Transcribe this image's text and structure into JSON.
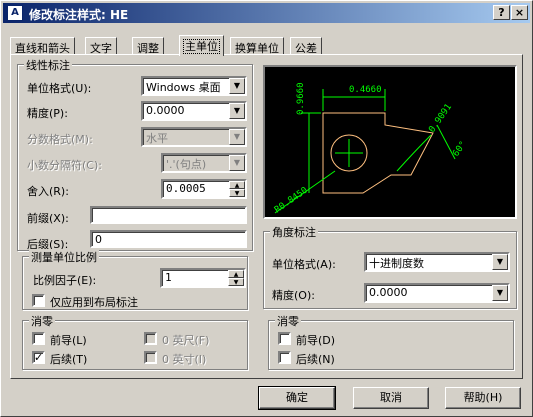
{
  "window": {
    "title": "修改标注样式: HE",
    "help_glyph": "?",
    "close_glyph": "×"
  },
  "tabs": [
    "直线和箭头",
    "文字",
    "调整",
    "主单位",
    "换算单位",
    "公差"
  ],
  "linear": {
    "group_title": "线性标注",
    "unit_format_label": "单位格式(U):",
    "unit_format_value": "Windows 桌面",
    "precision_label": "精度(P):",
    "precision_value": "0.0000",
    "fraction_label": "分数格式(M):",
    "fraction_value": "水平",
    "decimal_sep_label": "小数分隔符(C):",
    "decimal_sep_value": "'.'(句点)",
    "roundoff_label": "舍入(R):",
    "roundoff_value": "0.0005",
    "prefix_label": "前缀(X):",
    "prefix_value": "",
    "suffix_label": "后缀(S):",
    "suffix_value": "0"
  },
  "scale": {
    "group_title": "测量单位比例",
    "factor_label": "比例因子(E):",
    "factor_value": "1",
    "layout_only_label": "仅应用到布局标注",
    "layout_only_checked": false
  },
  "zero_linear": {
    "group_title": "消零",
    "leading_label": "前导(L)",
    "leading_checked": false,
    "trailing_label": "后续(T)",
    "trailing_checked": true,
    "feet_label": "0 英尺(F)",
    "inches_label": "0 英寸(I)"
  },
  "angular": {
    "group_title": "角度标注",
    "unit_format_label": "单位格式(A):",
    "unit_format_value": "十进制度数",
    "precision_label": "精度(O):",
    "precision_value": "0.0000"
  },
  "zero_angular": {
    "group_title": "消零",
    "leading_label": "前导(D)",
    "leading_checked": false,
    "trailing_label": "后续(N)",
    "trailing_checked": false
  },
  "preview": {
    "dim_top": "0.4660",
    "dim_left": "0.9660",
    "dim_right": "0.9091",
    "dim_angle": "60°",
    "dim_radius": "R0.8450",
    "colors": {
      "bg": "#000000",
      "dim": "#00ff00",
      "geometry": "#ffffff",
      "part": "#ffc080"
    }
  },
  "buttons": {
    "ok": "确定",
    "cancel": "取消",
    "help": "帮助(H)"
  },
  "icons": {
    "dropdown": "▼",
    "spin_up": "▲",
    "spin_down": "▼",
    "check": "✓"
  }
}
